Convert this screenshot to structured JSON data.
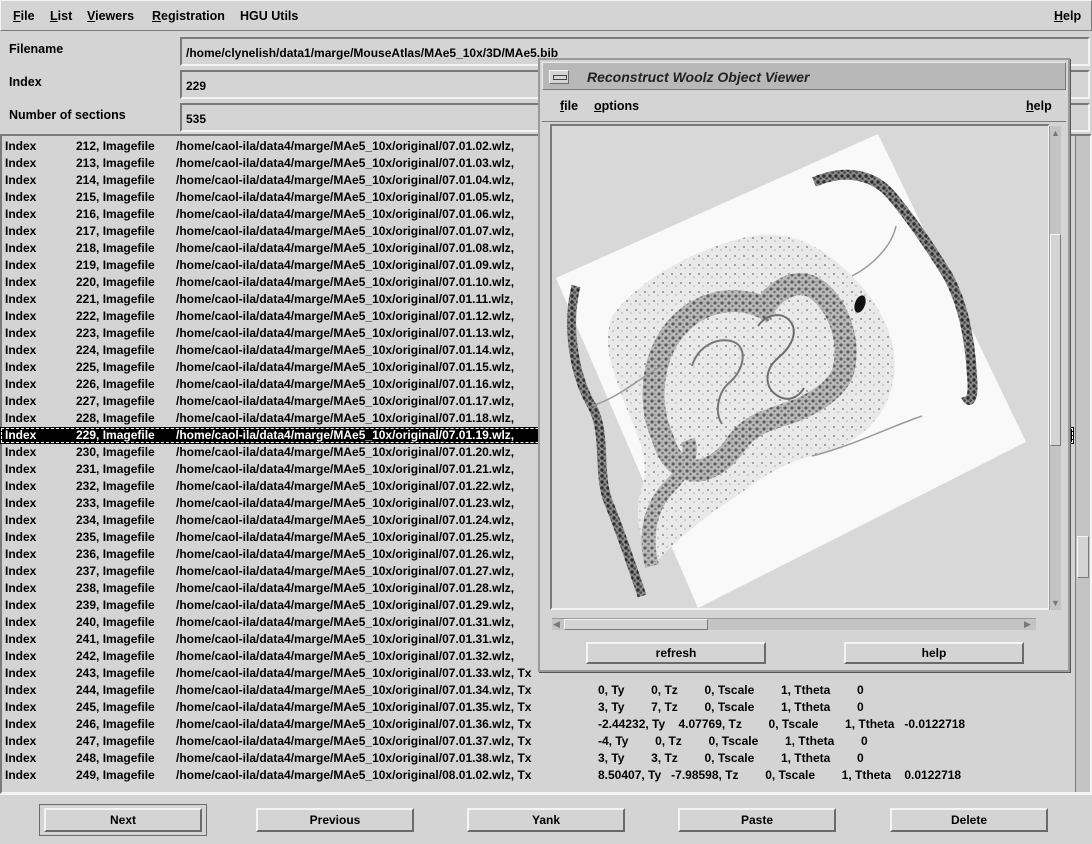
{
  "menubar": {
    "items": [
      {
        "mn": "F",
        "rest": "ile"
      },
      {
        "mn": "L",
        "rest": "ist"
      },
      {
        "mn": "V",
        "rest": "iewers"
      },
      {
        "mn": "R",
        "rest": "egistration"
      },
      {
        "mn": "",
        "rest": "HGU Utils"
      }
    ],
    "help": {
      "mn": "H",
      "rest": "elp"
    }
  },
  "header": {
    "filename_label": "Filename",
    "filename_value": "/home/clynelish/data1/marge/MouseAtlas/MAe5_10x/3D/MAe5.bib",
    "index_label": "Index",
    "index_value": "229",
    "sections_label": "Number of sections",
    "sections_value": "535"
  },
  "list": {
    "selected_index": "229",
    "rows": [
      {
        "i": "Index",
        "n": "212, Imagefile",
        "p": "/home/caol-ila/data4/marge/MAe5_10x/original/07.01.02.wlz,",
        "rest": ""
      },
      {
        "i": "Index",
        "n": "213, Imagefile",
        "p": "/home/caol-ila/data4/marge/MAe5_10x/original/07.01.03.wlz,",
        "rest": ""
      },
      {
        "i": "Index",
        "n": "214, Imagefile",
        "p": "/home/caol-ila/data4/marge/MAe5_10x/original/07.01.04.wlz,",
        "rest": ""
      },
      {
        "i": "Index",
        "n": "215, Imagefile",
        "p": "/home/caol-ila/data4/marge/MAe5_10x/original/07.01.05.wlz,",
        "rest": ""
      },
      {
        "i": "Index",
        "n": "216, Imagefile",
        "p": "/home/caol-ila/data4/marge/MAe5_10x/original/07.01.06.wlz,",
        "rest": ""
      },
      {
        "i": "Index",
        "n": "217, Imagefile",
        "p": "/home/caol-ila/data4/marge/MAe5_10x/original/07.01.07.wlz,",
        "rest": ""
      },
      {
        "i": "Index",
        "n": "218, Imagefile",
        "p": "/home/caol-ila/data4/marge/MAe5_10x/original/07.01.08.wlz,",
        "rest": ""
      },
      {
        "i": "Index",
        "n": "219, Imagefile",
        "p": "/home/caol-ila/data4/marge/MAe5_10x/original/07.01.09.wlz,",
        "rest": ""
      },
      {
        "i": "Index",
        "n": "220, Imagefile",
        "p": "/home/caol-ila/data4/marge/MAe5_10x/original/07.01.10.wlz,",
        "rest": ""
      },
      {
        "i": "Index",
        "n": "221, Imagefile",
        "p": "/home/caol-ila/data4/marge/MAe5_10x/original/07.01.11.wlz,",
        "rest": ""
      },
      {
        "i": "Index",
        "n": "222, Imagefile",
        "p": "/home/caol-ila/data4/marge/MAe5_10x/original/07.01.12.wlz,",
        "rest": ""
      },
      {
        "i": "Index",
        "n": "223, Imagefile",
        "p": "/home/caol-ila/data4/marge/MAe5_10x/original/07.01.13.wlz,",
        "rest": ""
      },
      {
        "i": "Index",
        "n": "224, Imagefile",
        "p": "/home/caol-ila/data4/marge/MAe5_10x/original/07.01.14.wlz,",
        "rest": ""
      },
      {
        "i": "Index",
        "n": "225, Imagefile",
        "p": "/home/caol-ila/data4/marge/MAe5_10x/original/07.01.15.wlz,",
        "rest": ""
      },
      {
        "i": "Index",
        "n": "226, Imagefile",
        "p": "/home/caol-ila/data4/marge/MAe5_10x/original/07.01.16.wlz,",
        "rest": ""
      },
      {
        "i": "Index",
        "n": "227, Imagefile",
        "p": "/home/caol-ila/data4/marge/MAe5_10x/original/07.01.17.wlz,",
        "rest": ""
      },
      {
        "i": "Index",
        "n": "228, Imagefile",
        "p": "/home/caol-ila/data4/marge/MAe5_10x/original/07.01.18.wlz,",
        "rest": ""
      },
      {
        "i": "Index",
        "n": "229, Imagefile",
        "p": "/home/caol-ila/data4/marge/MAe5_10x/original/07.01.19.wlz,",
        "rest": ""
      },
      {
        "i": "Index",
        "n": "230, Imagefile",
        "p": "/home/caol-ila/data4/marge/MAe5_10x/original/07.01.20.wlz,",
        "rest": ""
      },
      {
        "i": "Index",
        "n": "231, Imagefile",
        "p": "/home/caol-ila/data4/marge/MAe5_10x/original/07.01.21.wlz,",
        "rest": ""
      },
      {
        "i": "Index",
        "n": "232, Imagefile",
        "p": "/home/caol-ila/data4/marge/MAe5_10x/original/07.01.22.wlz,",
        "rest": ""
      },
      {
        "i": "Index",
        "n": "233, Imagefile",
        "p": "/home/caol-ila/data4/marge/MAe5_10x/original/07.01.23.wlz,",
        "rest": ""
      },
      {
        "i": "Index",
        "n": "234, Imagefile",
        "p": "/home/caol-ila/data4/marge/MAe5_10x/original/07.01.24.wlz,",
        "rest": ""
      },
      {
        "i": "Index",
        "n": "235, Imagefile",
        "p": "/home/caol-ila/data4/marge/MAe5_10x/original/07.01.25.wlz,",
        "rest": ""
      },
      {
        "i": "Index",
        "n": "236, Imagefile",
        "p": "/home/caol-ila/data4/marge/MAe5_10x/original/07.01.26.wlz,",
        "rest": ""
      },
      {
        "i": "Index",
        "n": "237, Imagefile",
        "p": "/home/caol-ila/data4/marge/MAe5_10x/original/07.01.27.wlz,",
        "rest": ""
      },
      {
        "i": "Index",
        "n": "238, Imagefile",
        "p": "/home/caol-ila/data4/marge/MAe5_10x/original/07.01.28.wlz,",
        "rest": ""
      },
      {
        "i": "Index",
        "n": "239, Imagefile",
        "p": "/home/caol-ila/data4/marge/MAe5_10x/original/07.01.29.wlz,",
        "rest": ""
      },
      {
        "i": "Index",
        "n": "240, Imagefile",
        "p": "/home/caol-ila/data4/marge/MAe5_10x/original/07.01.31.wlz,",
        "rest": ""
      },
      {
        "i": "Index",
        "n": "241, Imagefile",
        "p": "/home/caol-ila/data4/marge/MAe5_10x/original/07.01.31.wlz,",
        "rest": ""
      },
      {
        "i": "Index",
        "n": "242, Imagefile",
        "p": "/home/caol-ila/data4/marge/MAe5_10x/original/07.01.32.wlz,",
        "rest": ""
      },
      {
        "i": "Index",
        "n": "243, Imagefile",
        "p": "/home/caol-ila/data4/marge/MAe5_10x/original/07.01.33.wlz, Tx",
        "rest": ""
      },
      {
        "i": "Index",
        "n": "244, Imagefile",
        "p": "/home/caol-ila/data4/marge/MAe5_10x/original/07.01.34.wlz, Tx",
        "rest": "0, Ty        0, Tz        0, Tscale        1, Ttheta        0"
      },
      {
        "i": "Index",
        "n": "245, Imagefile",
        "p": "/home/caol-ila/data4/marge/MAe5_10x/original/07.01.35.wlz, Tx",
        "rest": "3, Ty        7, Tz        0, Tscale        1, Ttheta        0"
      },
      {
        "i": "Index",
        "n": "246, Imagefile",
        "p": "/home/caol-ila/data4/marge/MAe5_10x/original/07.01.36.wlz, Tx",
        "rest": "-2.44232, Ty    4.07769, Tz        0, Tscale        1, Ttheta   -0.0122718"
      },
      {
        "i": "Index",
        "n": "247, Imagefile",
        "p": "/home/caol-ila/data4/marge/MAe5_10x/original/07.01.37.wlz, Tx",
        "rest": "-4, Ty        0, Tz        0, Tscale        1, Ttheta        0"
      },
      {
        "i": "Index",
        "n": "248, Imagefile",
        "p": "/home/caol-ila/data4/marge/MAe5_10x/original/07.01.38.wlz, Tx",
        "rest": "3, Ty        3, Tz        0, Tscale        1, Ttheta        0"
      },
      {
        "i": "Index",
        "n": "249, Imagefile",
        "p": "/home/caol-ila/data4/marge/MAe5_10x/original/08.01.02.wlz, Tx",
        "rest": "8.50407, Ty   -7.98598, Tz        0, Tscale        1, Ttheta    0.0122718"
      }
    ]
  },
  "buttons": {
    "next": "Next",
    "previous": "Previous",
    "yank": "Yank",
    "paste": "Paste",
    "delete": "Delete"
  },
  "viewer": {
    "title": "Reconstruct Woolz Object Viewer",
    "menu_file": {
      "mn": "f",
      "rest": "ile"
    },
    "menu_options": {
      "mn": "o",
      "rest": "ptions"
    },
    "menu_help": {
      "mn": "h",
      "rest": "elp"
    },
    "refresh": "refresh",
    "help": "help"
  },
  "icons": [
    "window-menu-icon",
    "arrow-up-icon",
    "arrow-down-icon",
    "arrow-left-icon",
    "arrow-right-icon"
  ]
}
